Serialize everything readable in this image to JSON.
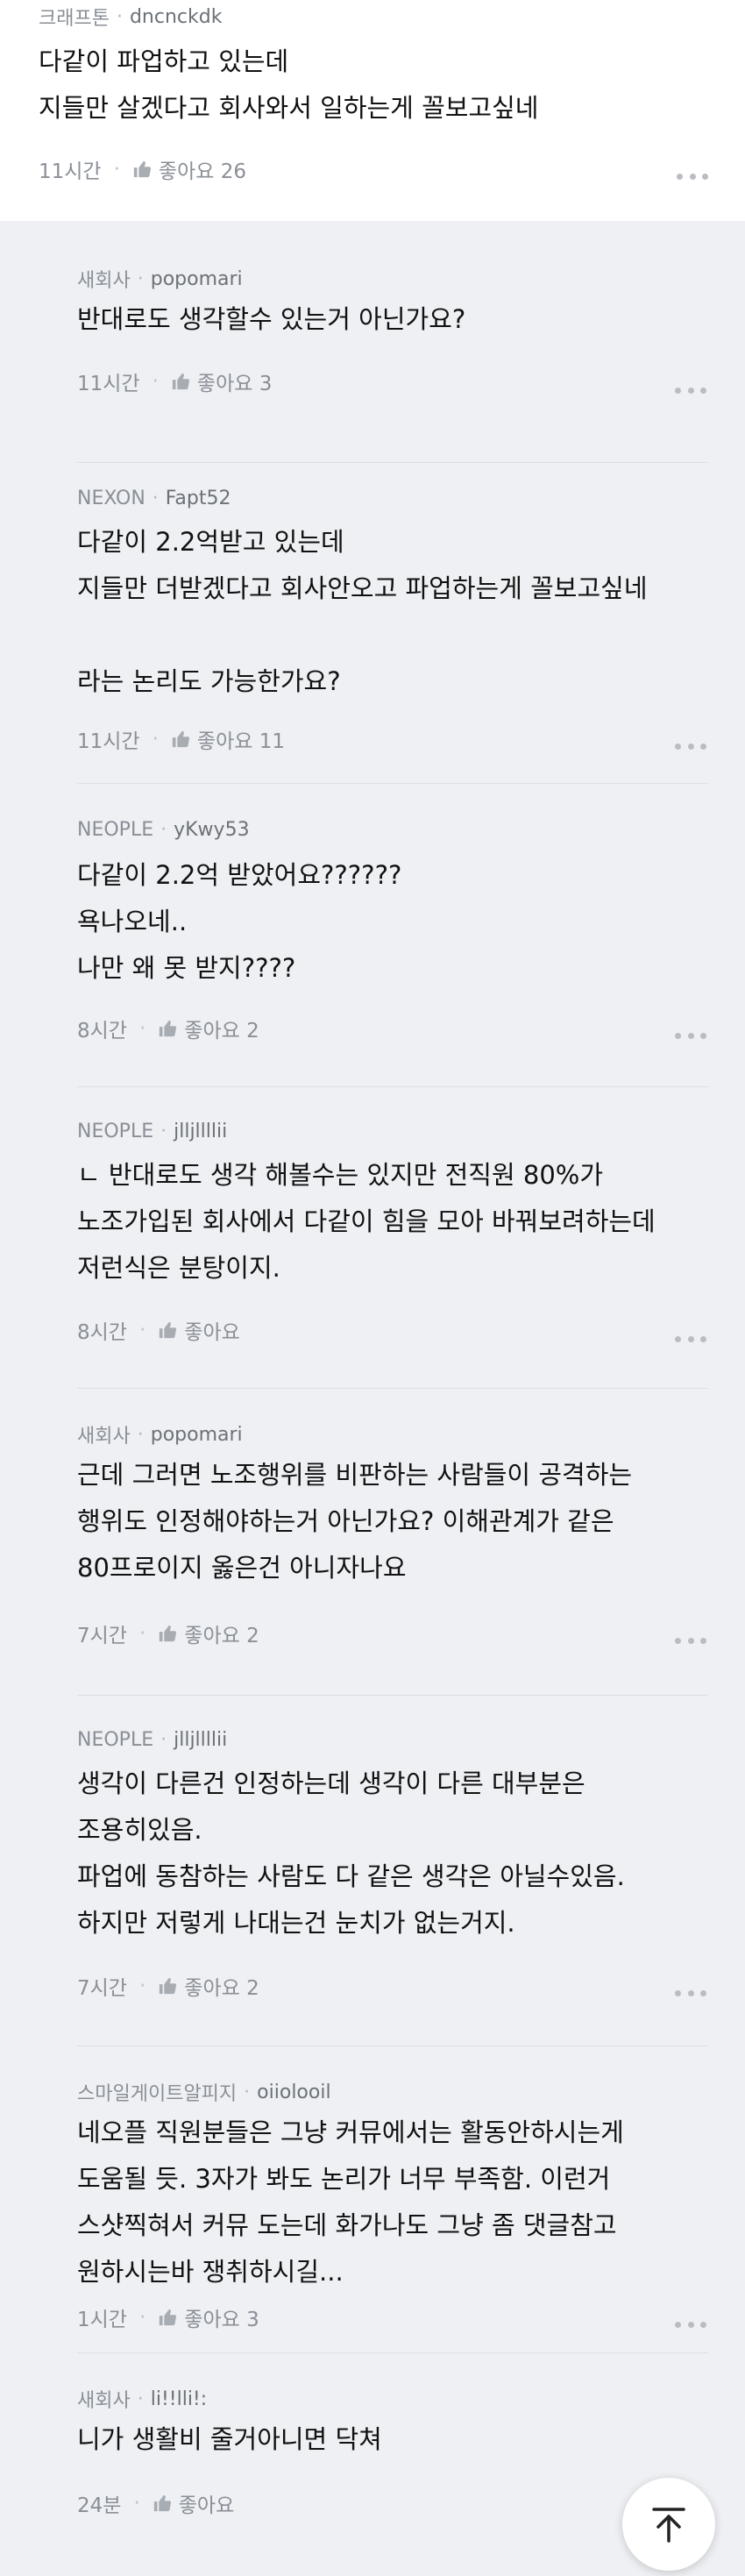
{
  "top_comment": {
    "company": "크래프톤",
    "nickname": "dncnckdk",
    "text": "다같이 파업하고 있는데\n지들만 살겠다고 회사와서 일하는게 꼴보고싶네",
    "time": "11시간",
    "like_label": "좋아요 26"
  },
  "replies": [
    {
      "company": "새회사",
      "nickname": "popomari",
      "text": "반대로도 생각할수 있는거 아닌가요?",
      "time": "11시간",
      "like_label": "좋아요 3"
    },
    {
      "company": "NEXON",
      "nickname": "Fapt52",
      "text": "다같이 2.2억받고 있는데\n지들만 더받겠다고 회사안오고 파업하는게 꼴보고싶네\n\n라는 논리도 가능한가요?",
      "time": "11시간",
      "like_label": "좋아요 11"
    },
    {
      "company": "NEOPLE",
      "nickname": "yKwy53",
      "text": "다같이 2.2억 받았어요??????\n욕나오네..\n나만 왜 못 받지????",
      "time": "8시간",
      "like_label": "좋아요 2"
    },
    {
      "company": "NEOPLE",
      "nickname": "jlljllllii",
      "text": "ㄴ 반대로도 생각 해볼수는 있지만 전직원 80%가\n노조가입된 회사에서 다같이 힘을 모아 바꿔보려하는데\n저런식은 분탕이지.",
      "time": "8시간",
      "like_label": "좋아요"
    },
    {
      "company": "새회사",
      "nickname": "popomari",
      "text": "근데 그러면 노조행위를 비판하는 사람들이 공격하는\n행위도 인정해야하는거 아닌가요? 이해관계가 같은\n80프로이지 옳은건 아니자나요",
      "time": "7시간",
      "like_label": "좋아요 2"
    },
    {
      "company": "NEOPLE",
      "nickname": "jlljllllii",
      "text": "생각이 다른건 인정하는데 생각이 다른 대부분은\n조용히있음.\n파업에 동참하는 사람도 다 같은 생각은 아닐수있음.\n하지만 저렇게 나대는건 눈치가 없는거지.",
      "time": "7시간",
      "like_label": "좋아요 2"
    },
    {
      "company": "스마일게이트알피지",
      "nickname": "oiiolooil",
      "text": "네오플 직원분들은 그냥 커뮤에서는 활동안하시는게\n도움될 듯. 3자가 봐도 논리가 너무 부족함. 이런거\n스샷찍혀서 커뮤 도는데 화가나도 그냥 좀 댓글참고\n원하시는바 쟁취하시길...",
      "time": "1시간",
      "like_label": "좋아요 3"
    },
    {
      "company": "새회사",
      "nickname": "li!!lli!:",
      "text": "니가 생활비 줄거아니면 닥쳐",
      "time": "24분",
      "like_label": "좋아요"
    }
  ],
  "scroll_top_icon": "arrow-up-to-top-icon"
}
